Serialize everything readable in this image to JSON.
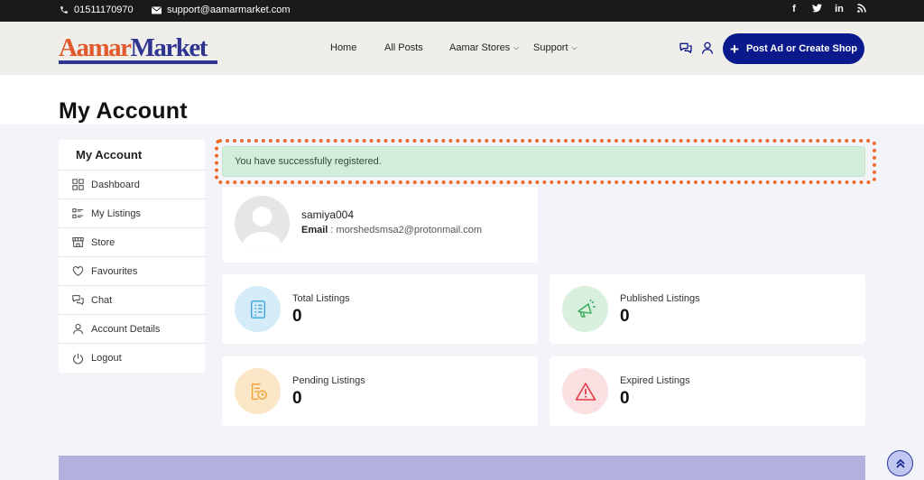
{
  "topbar": {
    "phone": "01511170970",
    "email": "support@aamarmarket.com",
    "social": [
      {
        "icon": "facebook-icon",
        "glyph": "f"
      },
      {
        "icon": "twitter-icon",
        "glyph": "t"
      },
      {
        "icon": "linkedin-icon",
        "glyph": "in"
      },
      {
        "icon": "rss-icon",
        "glyph": ")"
      }
    ]
  },
  "logo": {
    "part1": "Aamar",
    "part2": "Market"
  },
  "nav": {
    "home": "Home",
    "all_posts": "All Posts",
    "aamar_stores": "Aamar Stores",
    "support": "Support",
    "cta": "Post Ad or Create Shop"
  },
  "page": {
    "title": "My Account"
  },
  "sidebar": {
    "title": "My Account",
    "items": [
      {
        "label": "Dashboard",
        "icon": "dashboard-icon"
      },
      {
        "label": "My Listings",
        "icon": "listings-icon"
      },
      {
        "label": "Store",
        "icon": "store-icon"
      },
      {
        "label": "Favourites",
        "icon": "heart-icon"
      },
      {
        "label": "Chat",
        "icon": "chat-icon"
      },
      {
        "label": "Account Details",
        "icon": "user-icon"
      },
      {
        "label": "Logout",
        "icon": "power-icon"
      }
    ]
  },
  "alert": {
    "message": "You have successfully registered."
  },
  "profile": {
    "username": "samiya004",
    "email_label": "Email",
    "email_sep": " : ",
    "email": "morshedsmsa2@protonmail.com"
  },
  "stats": {
    "total": {
      "label": "Total Listings",
      "value": "0",
      "color": "#3ba4dc",
      "bg": "#d4ecf8",
      "icon": "list-icon"
    },
    "published": {
      "label": "Published Listings",
      "value": "0",
      "color": "#3fae5f",
      "bg": "#d8f0dd",
      "icon": "megaphone-icon"
    },
    "pending": {
      "label": "Pending Listings",
      "value": "0",
      "color": "#f0a030",
      "bg": "#fbe6c8",
      "icon": "pending-clock-icon"
    },
    "expired": {
      "label": "Expired Listings",
      "value": "0",
      "color": "#e0384a",
      "bg": "#fbe0e2",
      "icon": "warning-icon"
    }
  },
  "colors": {
    "brand_blue": "#0a1a8c",
    "brand_orange": "#e05a2b",
    "highlight": "#ee6a2a"
  }
}
